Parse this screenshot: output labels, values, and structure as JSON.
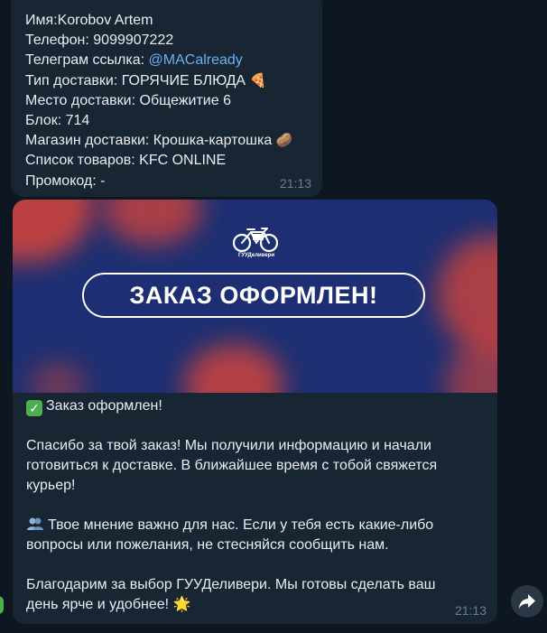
{
  "message1": {
    "lines": [
      {
        "label": "Имя:",
        "value": "Korobov Artem"
      },
      {
        "label": "Телефон: ",
        "value": "9099907222"
      },
      {
        "label": "Телеграм ссылка: ",
        "value": "@MACalready"
      },
      {
        "label": "Тип доставки: ",
        "value": "ГОРЯЧИЕ БЛЮДА",
        "emoji": "🍕"
      },
      {
        "label": "Место доставки: ",
        "value": "Общежитие 6"
      },
      {
        "label": "Блок: ",
        "value": "714"
      },
      {
        "label": "Магазин доставки: ",
        "value": "Крошка-картошка",
        "emoji": "🥔"
      },
      {
        "label": "Список товаров: ",
        "value": "KFC ONLINE"
      },
      {
        "label": "Промокод: ",
        "value": "-"
      }
    ],
    "time": "21:13"
  },
  "message2": {
    "banner": {
      "logo_text": "ГУУДеливери",
      "title": "ЗАКАЗ ОФОРМЛЕН!"
    },
    "paragraphs": {
      "p1": "Заказ оформлен!",
      "p2_line1": "Спасибо за твой заказ! Мы получили информацию и начали",
      "p2_line2": "готовиться к доставке. В ближайшее время с тобой свяжется",
      "p2_line3": "курьер!",
      "p3_line1": "Твое мнение важно для нас. Если у тебя есть какие-либо",
      "p3_line2": "вопросы или пожелания, не стесняйся сообщить нам.",
      "p4_line1": "Благодарим за выбор ГУУДеливери. Мы готовы сделать ваш",
      "p4_line2": "день ярче и удобнее!"
    },
    "emojis": {
      "check": "✓",
      "star": "🌟"
    },
    "time": "21:13"
  },
  "icons": {
    "forward": "forward-arrow-icon",
    "bike": "bicycle-icon"
  },
  "colors": {
    "background": "#0e1621",
    "bubble": "#182533",
    "link": "#6ab2f2",
    "banner_blue": "#1d2f72",
    "banner_red": "#d9453a"
  }
}
